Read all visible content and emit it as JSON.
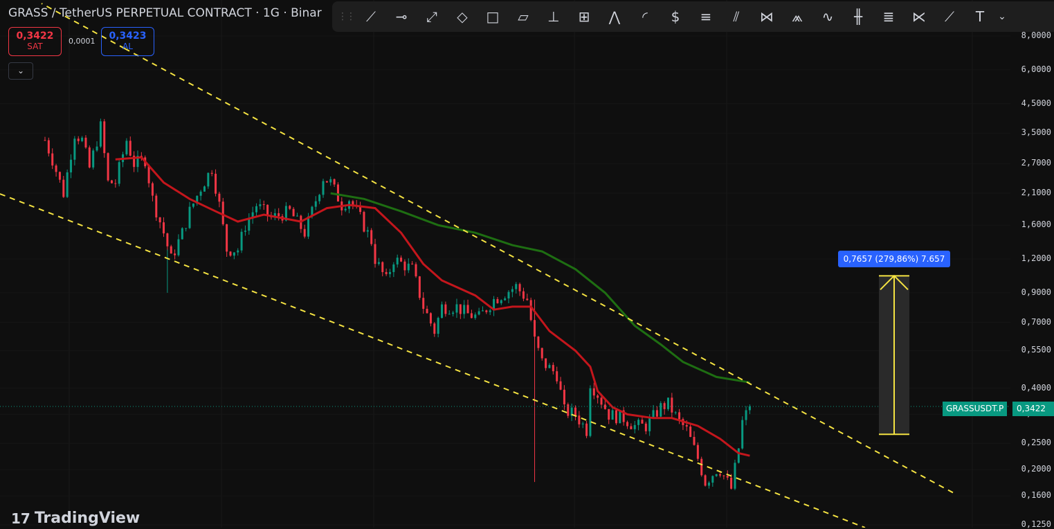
{
  "header": {
    "title": "GRASS / TetherUS PERPETUAL CONTRACT · 1G · Binar",
    "sell_price": "0,3422",
    "sell_label": "SAT",
    "spread": "0,0001",
    "buy_price": "0,3423",
    "buy_label": "AL",
    "collapse_icon": "chevron-down-icon"
  },
  "toolbar": {
    "icons": [
      "trend-line-icon",
      "horizontal-ray-icon",
      "info-line-icon",
      "rectangle-rotated-icon",
      "rectangle-icon",
      "parallel-channel-icon",
      "price-range-icon",
      "date-price-range-icon",
      "pitchfork-icon",
      "arc-icon",
      "long-position-icon",
      "fib-retracement-icon",
      "fib-channel-icon",
      "xabcd-pattern-icon",
      "head-shoulders-icon",
      "elliott-wave-icon",
      "bars-pattern-icon",
      "fib-timezone-icon",
      "cypher-pattern-icon",
      "path-icon",
      "text-icon",
      "dropdown-icon"
    ]
  },
  "price_tag": {
    "symbol": "GRASSUSDT.P",
    "last": "0,3422"
  },
  "measure_label": "0,7657 (279,86%) 7.657",
  "logo": "TradingView",
  "colors": {
    "up": "#089981",
    "down": "#f23645",
    "ma_fast": "#c4161c",
    "ma_slow": "#1e6e12",
    "channel": "#f5e342",
    "measure": "#f5e342",
    "label_bg": "#2962ff"
  },
  "chart_data": {
    "type": "candlestick",
    "y_scale": "log",
    "ylim": [
      0.125,
      8.0
    ],
    "y_ticks": [
      "8,0000",
      "6,0000",
      "4,5000",
      "3,5000",
      "2,7000",
      "2,1000",
      "1,6000",
      "1,2000",
      "0,9000",
      "0,7000",
      "0,5500",
      "0,4000",
      "0,3200",
      "0,2500",
      "0,2000",
      "0,1600",
      "0,1250"
    ],
    "y_tick_values": [
      8,
      6,
      4.5,
      3.5,
      2.7,
      2.1,
      1.6,
      1.2,
      0.9,
      0.7,
      0.55,
      0.4,
      0.32,
      0.25,
      0.2,
      0.16,
      0.125
    ],
    "price_waypoints": {
      "bar": [
        0,
        2,
        5,
        8,
        10,
        12,
        15,
        17,
        19,
        22,
        24,
        27,
        29,
        32,
        34,
        37,
        39,
        42,
        45,
        47,
        49,
        52,
        54,
        57,
        61,
        66,
        70,
        72,
        75,
        77,
        80,
        82,
        85,
        88,
        89,
        92,
        94,
        99,
        102,
        105,
        107,
        111,
        114,
        117,
        121,
        124,
        127,
        130,
        132,
        134,
        138,
        140,
        143,
        146,
        147,
        149,
        152,
        156,
        159,
        162,
        166,
        168,
        171,
        173,
        176,
        178,
        181,
        182,
        185,
        187,
        188,
        190
      ],
      "close": [
        3.3,
        2.8,
        2.1,
        3.5,
        3.3,
        2.6,
        3.7,
        2.3,
        2.3,
        3.3,
        2.7,
        2.8,
        2.0,
        1.5,
        1.2,
        1.5,
        1.8,
        2.2,
        2.6,
        1.9,
        1.3,
        1.3,
        1.6,
        1.9,
        1.7,
        1.8,
        1.5,
        1.8,
        2.4,
        2.3,
        1.9,
        2.0,
        1.7,
        1.4,
        1.2,
        1.0,
        1.2,
        1.1,
        0.8,
        0.65,
        0.8,
        0.8,
        0.75,
        0.73,
        0.85,
        0.9,
        0.95,
        0.85,
        0.6,
        0.5,
        0.45,
        0.33,
        0.32,
        0.28,
        0.42,
        0.38,
        0.32,
        0.31,
        0.29,
        0.29,
        0.34,
        0.35,
        0.3,
        0.28,
        0.22,
        0.18,
        0.2,
        0.2,
        0.17,
        0.24,
        0.3,
        0.3422
      ]
    },
    "ma_fast": {
      "bar": [
        19,
        26,
        32,
        39,
        46,
        52,
        59,
        69,
        76,
        82,
        89,
        96,
        102,
        107,
        116,
        121,
        126,
        131,
        136,
        143,
        147,
        149,
        153,
        157,
        164,
        169,
        176,
        182,
        187,
        190
      ],
      "value": [
        2.8,
        2.85,
        2.3,
        2.0,
        1.8,
        1.65,
        1.75,
        1.65,
        1.85,
        1.9,
        1.85,
        1.5,
        1.15,
        1.0,
        0.88,
        0.78,
        0.8,
        0.8,
        0.65,
        0.55,
        0.48,
        0.39,
        0.34,
        0.32,
        0.31,
        0.31,
        0.29,
        0.26,
        0.23,
        0.225
      ]
    },
    "ma_slow": {
      "bar": [
        77,
        86,
        96,
        106,
        116,
        126,
        134,
        143,
        151,
        159,
        166,
        172,
        181,
        190
      ],
      "value": [
        2.1,
        2.0,
        1.8,
        1.6,
        1.5,
        1.35,
        1.28,
        1.1,
        0.9,
        0.68,
        0.58,
        0.5,
        0.44,
        0.42
      ]
    },
    "last_price": 0.3422,
    "measure": {
      "from": 0.27,
      "to": 1.04,
      "change": "0,7657 (279,86%) 7.657"
    }
  }
}
